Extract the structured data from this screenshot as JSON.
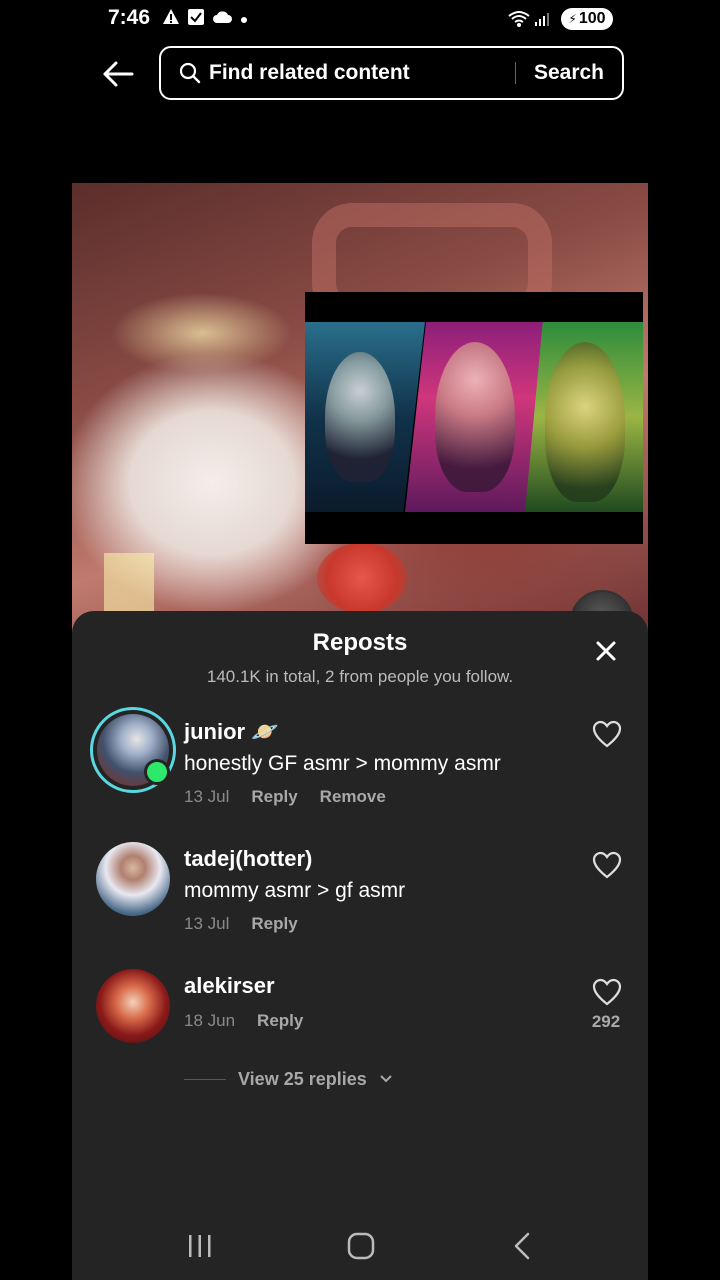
{
  "status_bar": {
    "time": "7:46",
    "battery": "100",
    "icons": [
      "alert-icon",
      "check-box-icon",
      "cloud-icon",
      "dot-icon",
      "wifi-icon",
      "signal-icon",
      "battery-icon"
    ]
  },
  "search": {
    "placeholder": "Find related content",
    "button_label": "Search"
  },
  "sheet": {
    "title": "Reposts",
    "subtitle": "140.1K in total, 2 from people you follow.",
    "comments": [
      {
        "username": "junior 🪐",
        "text": "honestly GF asmr > mommy asmr",
        "date": "13 Jul",
        "reply": "Reply",
        "remove": "Remove"
      },
      {
        "username": "tadej(hotter)",
        "text": "mommy asmr > gf asmr",
        "date": "13 Jul",
        "reply": "Reply"
      },
      {
        "username": "alekirser",
        "date": "18 Jun",
        "reply": "Reply",
        "likes": "292"
      }
    ],
    "view_replies": "View 25 replies"
  },
  "colors": {
    "background": "#000000",
    "sheet": "#242424",
    "online_dot": "#2ee86b",
    "story_ring": "#5ad7e0"
  }
}
